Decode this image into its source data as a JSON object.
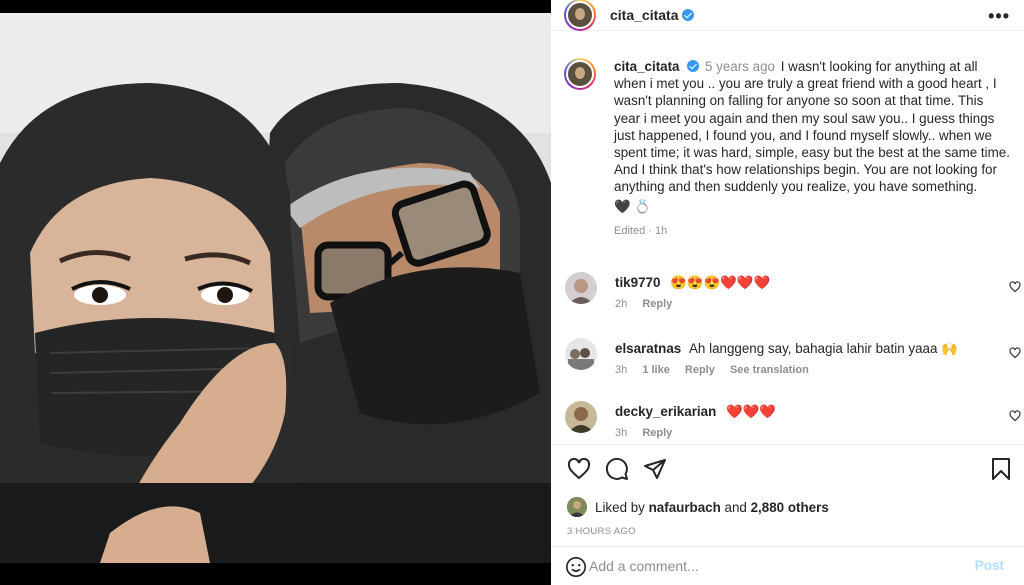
{
  "post": {
    "author": "cita_citata",
    "more_icon": "more-horizontal-icon"
  },
  "caption": {
    "author": "cita_citata",
    "time": "5 years ago",
    "paragraph1": "I wasn't looking for anything at all when i met you .. you are truly a great friend with a good heart , I wasn't planning on falling for anyone so soon at that time. This year i meet you again and then my soul saw you.. I guess things just happened, I found you, and I found myself slowly.. when we spent time; it was hard, simple, easy but the best at the same time.",
    "paragraph2": "And I think that's how relationships begin. You are not looking for anything and then suddenly you realize, you have something.",
    "emoji": "🖤 💍",
    "edited": "Edited · 1h"
  },
  "comments": [
    {
      "user": "tik9770",
      "text": "😍😍😍❤️❤️❤️",
      "time": "2h",
      "likes": "",
      "reply": "Reply",
      "translate": ""
    },
    {
      "user": "elsaratnas",
      "text": "Ah langgeng say, bahagia lahir batin yaaa 🙌",
      "time": "3h",
      "likes": "1 like",
      "reply": "Reply",
      "translate": "See translation"
    },
    {
      "user": "decky_erikarian",
      "text": "❤️❤️❤️",
      "time": "3h",
      "likes": "",
      "reply": "Reply",
      "translate": ""
    }
  ],
  "likes": {
    "prefix": "Liked by",
    "user": "nafaurbach",
    "and": "and",
    "others": "2,880 others"
  },
  "timestamp": "3 HOURS AGO",
  "comment_box": {
    "placeholder": "Add a comment...",
    "post_label": "Post"
  },
  "colors": {
    "link_blue": "#b2dffc",
    "verified_blue": "#3897f0",
    "heart_red": "#ed4956"
  }
}
